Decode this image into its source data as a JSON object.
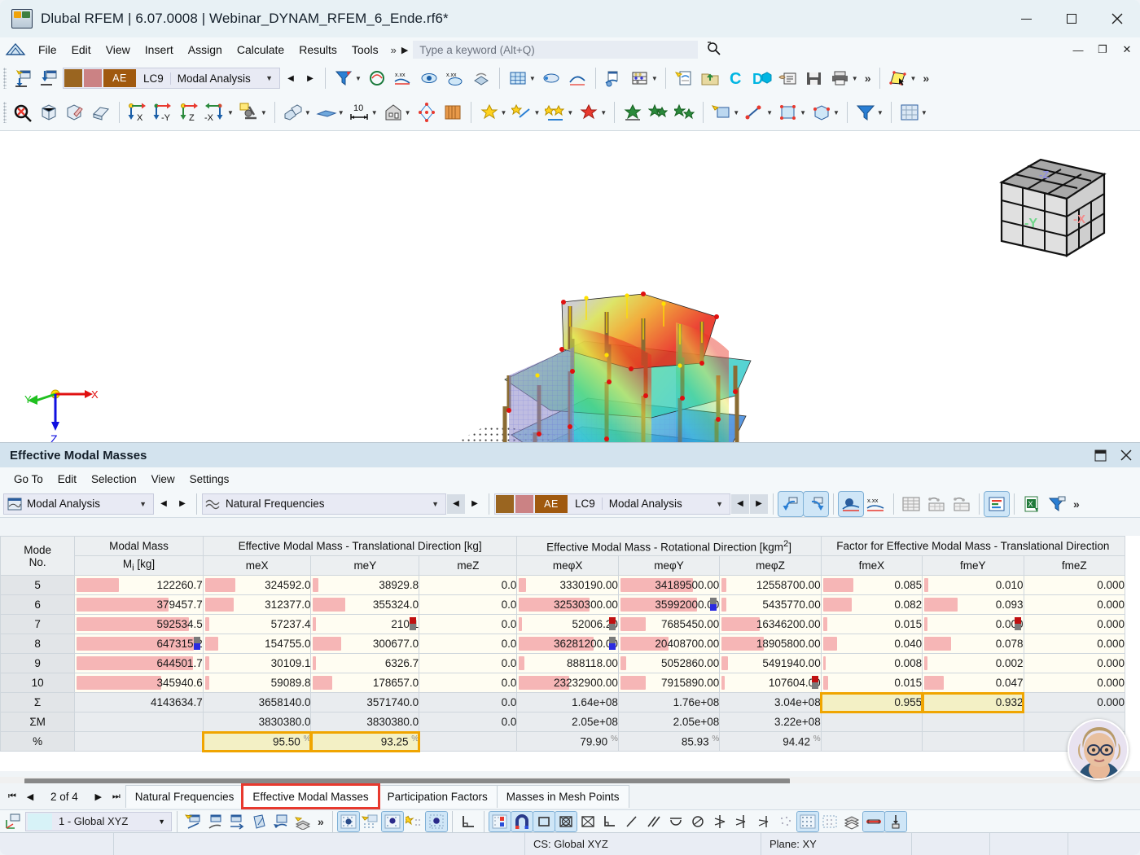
{
  "window": {
    "title": "Dlubal RFEM | 6.07.0008 | Webinar_DYNAM_RFEM_6_Ende.rf6*",
    "minimize": "—",
    "maximize": "□",
    "close": "✕"
  },
  "menubar": {
    "items": [
      "File",
      "Edit",
      "View",
      "Insert",
      "Assign",
      "Calculate",
      "Results",
      "Tools"
    ],
    "overflow": "»",
    "play": "▶",
    "search_placeholder": "Type a keyword (Alt+Q)"
  },
  "toolbar_main": {
    "load_case": {
      "code": "LC9",
      "name": "Modal Analysis",
      "ae": "AE",
      "color_brown": "#9a6520",
      "color_rose": "#cb8284",
      "color_ae": "#a0590f"
    },
    "overflow": "»"
  },
  "viewport": {
    "axes": {
      "x": "X",
      "y": "Y",
      "z": "Z"
    },
    "navcube": {
      "front": "-Y",
      "right": "-X",
      "top": "-Z"
    }
  },
  "panel": {
    "title": "Effective Modal Masses",
    "menu": [
      "Go To",
      "Edit",
      "Selection",
      "View",
      "Settings"
    ],
    "combo_analysis": "Modal Analysis",
    "combo_result": "Natural Frequencies",
    "load_case": {
      "code": "LC9",
      "name": "Modal Analysis",
      "ae": "AE"
    },
    "overflow": "»"
  },
  "table": {
    "group_headers": [
      {
        "label": "Mode",
        "sub": "No.",
        "span": 1,
        "cls": "c-mode"
      },
      {
        "label": "Modal Mass",
        "sub": "",
        "span": 1,
        "cls": "c-mm"
      },
      {
        "label": "Effective Modal Mass - Translational Direction [kg]",
        "span": 3
      },
      {
        "label": "Effective Modal Mass - Rotational Direction [kgm2]",
        "span": 3
      },
      {
        "label": "Factor for Effective Modal Mass - Translational Direction",
        "span": 3
      }
    ],
    "sub_headers": [
      "Mode No.",
      "Mi [kg]",
      "meX",
      "meY",
      "meZ",
      "meφX",
      "meφY",
      "meφZ",
      "fmeX",
      "fmeY",
      "fmeZ"
    ],
    "rows": [
      {
        "mode": "5",
        "mi": "122260.7",
        "mex": "324592.0",
        "mey": "38929.8",
        "mez": "0.0",
        "mphx": "3330190.00",
        "mphy": "34189500.00",
        "mphz": "12558700.00",
        "fmex": "0.085",
        "fmey": "0.010",
        "fmez": "0.000",
        "bars": {
          "mi": 33,
          "mex": 28,
          "mey": 5,
          "mphx": 7,
          "mphy": 72,
          "mphz": 5,
          "fmex": 30,
          "fmey": 4
        },
        "flags": {}
      },
      {
        "mode": "6",
        "mi": "379457.7",
        "mex": "312377.0",
        "mey": "355324.0",
        "mez": "0.0",
        "mphx": "32530300.00",
        "mphy": "35992000.00",
        "mphz": "5435770.00",
        "fmex": "0.082",
        "fmey": "0.093",
        "fmez": "0.000",
        "bars": {
          "mi": 72,
          "mex": 27,
          "mey": 30,
          "mphx": 70,
          "mphy": 76,
          "mphz": 5,
          "fmex": 29,
          "fmey": 33
        },
        "flags": {
          "mphy": "gray-blue"
        }
      },
      {
        "mode": "7",
        "mi": "592534.5",
        "mex": "57237.4",
        "mey": "210.1",
        "mez": "0.0",
        "mphx": "52006.20",
        "mphy": "7685450.00",
        "mphz": "16346200.00",
        "fmex": "0.015",
        "fmey": "0.000",
        "fmez": "0.000",
        "bars": {
          "mi": 88,
          "mex": 4,
          "mey": 3,
          "mphx": 3,
          "mphy": 25,
          "mphz": 38,
          "fmex": 4,
          "fmey": 3
        },
        "flags": {
          "mey": "red-gray",
          "mphx": "red-gray",
          "fmey": "red-gray"
        }
      },
      {
        "mode": "8",
        "mi": "647315.2",
        "mex": "154755.0",
        "mey": "300677.0",
        "mez": "0.0",
        "mphx": "36281200.00",
        "mphy": "20408700.00",
        "mphz": "18905800.00",
        "fmex": "0.040",
        "fmey": "0.078",
        "fmez": "0.000",
        "bars": {
          "mi": 92,
          "mex": 12,
          "mey": 26,
          "mphx": 74,
          "mphy": 48,
          "mphz": 42,
          "fmex": 14,
          "fmey": 27
        },
        "flags": {
          "mi": "gray-blue",
          "mphx": "gray-blue"
        }
      },
      {
        "mode": "9",
        "mi": "644501.7",
        "mex": "30109.1",
        "mey": "6326.7",
        "mez": "0.0",
        "mphx": "888118.00",
        "mphy": "5052860.00",
        "mphz": "5491940.00",
        "fmex": "0.008",
        "fmey": "0.002",
        "fmez": "0.000",
        "bars": {
          "mi": 91,
          "mex": 4,
          "mey": 3,
          "mphx": 5,
          "mphy": 6,
          "mphz": 6,
          "fmex": 3,
          "fmey": 3
        },
        "flags": {}
      },
      {
        "mode": "10",
        "mi": "345940.6",
        "mex": "59089.8",
        "mey": "178657.0",
        "mez": "0.0",
        "mphx": "23232900.00",
        "mphy": "7915890.00",
        "mphz": "107604.00",
        "fmex": "0.015",
        "fmey": "0.047",
        "fmez": "0.000",
        "bars": {
          "mi": 66,
          "mex": 4,
          "mey": 18,
          "mphx": 50,
          "mphy": 25,
          "mphz": 3,
          "fmex": 5,
          "fmey": 19
        },
        "flags": {
          "mphz": "red-gray"
        }
      }
    ],
    "sum_row": {
      "label": "Σ",
      "mi": "4143634.7",
      "mex": "3658140.0",
      "mey": "3571740.0",
      "mez": "0.0",
      "mphx": "1.64e+08",
      "mphy": "1.76e+08",
      "mphz": "3.04e+08",
      "fmex": "0.955",
      "fmey": "0.932",
      "fmez": "0.000"
    },
    "summ_row": {
      "label": "ΣM",
      "mi": "",
      "mex": "3830380.0",
      "mey": "3830380.0",
      "mez": "0.0",
      "mphx": "2.05e+08",
      "mphy": "2.05e+08",
      "mphz": "3.22e+08",
      "fmex": "",
      "fmey": "",
      "fmez": ""
    },
    "pct_row": {
      "label": "%",
      "mi": "",
      "mex": "95.50",
      "mey": "93.25",
      "mez": "",
      "mphx": "79.90",
      "mphy": "85.93",
      "mphz": "94.42",
      "fmex": "",
      "fmey": "",
      "fmez": "",
      "unit": "%"
    },
    "highlight_color": "#f0a500"
  },
  "tabs": {
    "page_indicator": "2 of 4",
    "first": "⏮",
    "prev": "◀",
    "next": "▶",
    "last": "⏭",
    "items": [
      {
        "label": "Natural Frequencies",
        "active": false,
        "boxed": false
      },
      {
        "label": "Effective Modal Masses",
        "active": true,
        "boxed": true
      },
      {
        "label": "Participation Factors",
        "active": false,
        "boxed": false
      },
      {
        "label": "Masses in Mesh Points",
        "active": false,
        "boxed": false
      }
    ],
    "box_color": "#e8392e"
  },
  "bottombar": {
    "cs_selector": "1 - Global XYZ",
    "overflow": "»"
  },
  "statusbar": {
    "cs": "CS: Global XYZ",
    "plane": "Plane: XY"
  }
}
